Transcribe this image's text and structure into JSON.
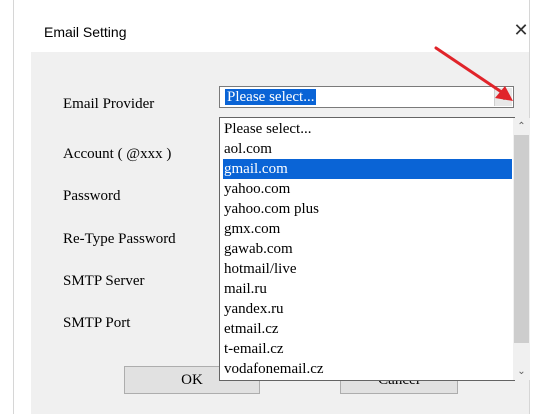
{
  "window": {
    "title": "Email Setting",
    "close_glyph": "✕"
  },
  "form": {
    "labels": {
      "provider": "Email Provider",
      "account": "Account ( @xxx )",
      "password": "Password",
      "retype": "Re-Type Password",
      "smtp_server": "SMTP Server",
      "smtp_port": "SMTP Port"
    },
    "provider_value": "Please select...",
    "ok_label": "OK",
    "cancel_label": "Cancel"
  },
  "dropdown": {
    "options": [
      "Please select...",
      "aol.com",
      "gmail.com",
      "yahoo.com",
      "yahoo.com plus",
      "gmx.com",
      "gawab.com",
      "hotmail/live",
      "mail.ru",
      "yandex.ru",
      "etmail.cz",
      "t-email.cz",
      "vodafonemail.cz"
    ],
    "highlighted_index": 2
  },
  "colors": {
    "highlight": "#0a64d6",
    "annotation_arrow": "#e0242a",
    "dialog_bg": "#f0f0f0"
  },
  "icons": {
    "close": "close-icon",
    "combo_arrow": "chevron-down-icon",
    "scroll_up": "scroll-up-icon",
    "scroll_down": "scroll-down-icon"
  }
}
